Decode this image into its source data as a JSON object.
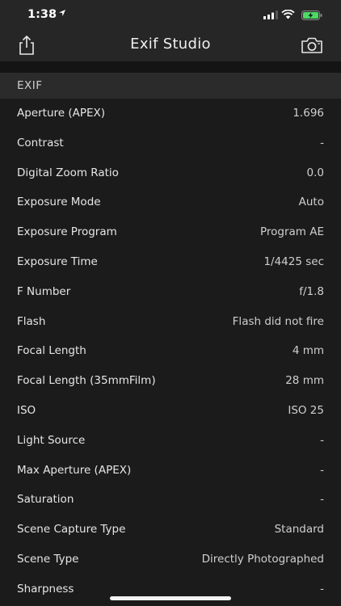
{
  "status": {
    "time": "1:38"
  },
  "nav": {
    "title": "Exif Studio",
    "left_icon": "share-icon",
    "right_icon": "camera-icon"
  },
  "section": {
    "title": "EXIF"
  },
  "rows": [
    {
      "label": "Aperture (APEX)",
      "value": "1.696"
    },
    {
      "label": "Contrast",
      "value": "-"
    },
    {
      "label": "Digital Zoom Ratio",
      "value": "0.0"
    },
    {
      "label": "Exposure Mode",
      "value": "Auto"
    },
    {
      "label": "Exposure Program",
      "value": "Program AE"
    },
    {
      "label": "Exposure Time",
      "value": "1/4425 sec"
    },
    {
      "label": "F Number",
      "value": "f/1.8"
    },
    {
      "label": "Flash",
      "value": "Flash did not fire"
    },
    {
      "label": "Focal Length",
      "value": "4 mm"
    },
    {
      "label": "Focal Length (35mmFilm)",
      "value": "28 mm"
    },
    {
      "label": "ISO",
      "value": "ISO 25"
    },
    {
      "label": "Light Source",
      "value": "-"
    },
    {
      "label": "Max Aperture (APEX)",
      "value": "-"
    },
    {
      "label": "Saturation",
      "value": "-"
    },
    {
      "label": "Scene Capture Type",
      "value": "Standard"
    },
    {
      "label": "Scene Type",
      "value": "Directly Photographed"
    },
    {
      "label": "Sharpness",
      "value": "-"
    }
  ]
}
